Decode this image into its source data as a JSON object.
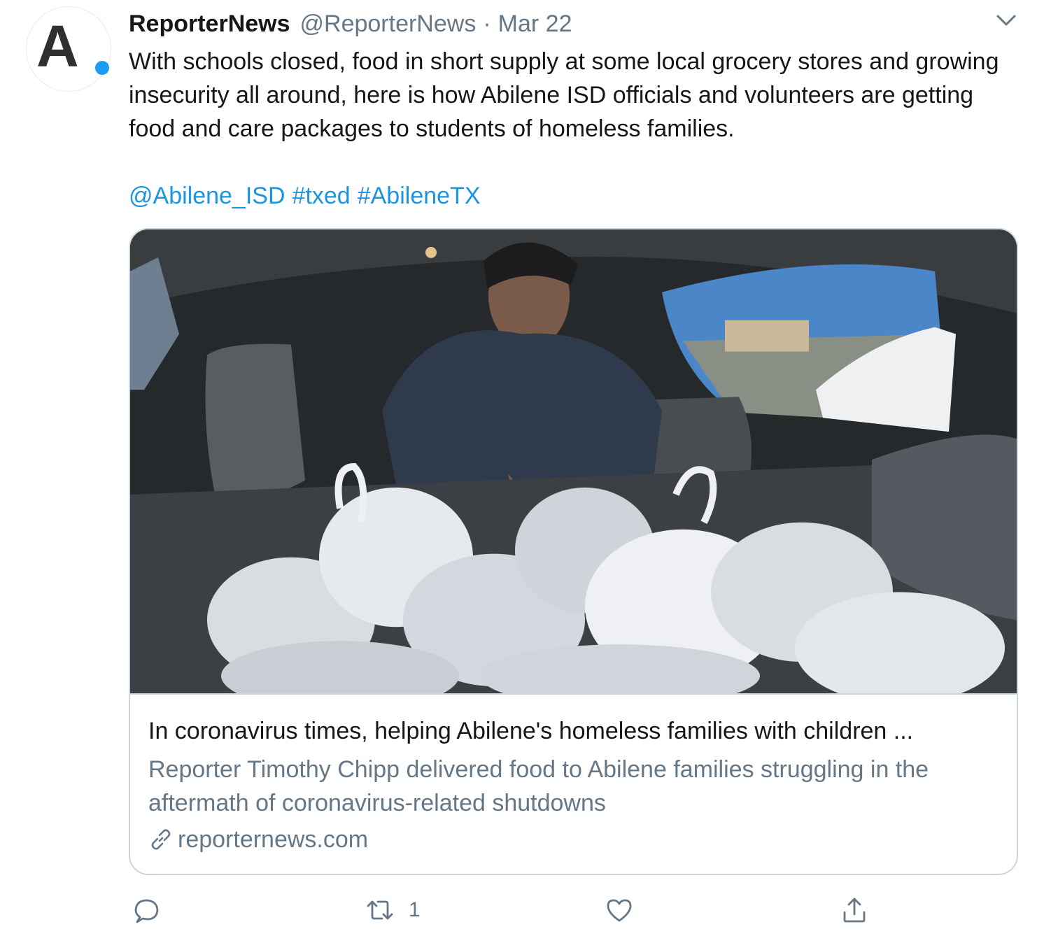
{
  "tweet": {
    "author_name": "ReporterNews",
    "handle": "@ReporterNews",
    "separator": "·",
    "date": "Mar 22",
    "avatar_letter": "A",
    "text": "With schools closed, food in short supply at some local grocery stores and growing insecurity all around, here is how Abilene ISD officials and volunteers are getting food and care packages to students of homeless families.",
    "tags": [
      "@Abilene_ISD",
      "#txed",
      "#AbileneTX"
    ]
  },
  "card": {
    "image_description_icon": "photo",
    "title": "In coronavirus times, helping Abilene's homeless families with children ...",
    "description": "Reporter Timothy Chipp delivered food to Abilene families struggling in the aftermath of coronavirus-related shutdowns",
    "domain": "reporternews.com"
  },
  "actions": {
    "reply_count": "",
    "retweet_count": "1",
    "like_count": "",
    "icons": [
      "reply-icon",
      "retweet-icon",
      "like-icon",
      "share-icon"
    ]
  },
  "colors": {
    "link": "#1b95e0",
    "muted": "#657786",
    "text": "#14171a",
    "border": "#ccd6dd",
    "brand_dot": "#1d9bf0"
  }
}
